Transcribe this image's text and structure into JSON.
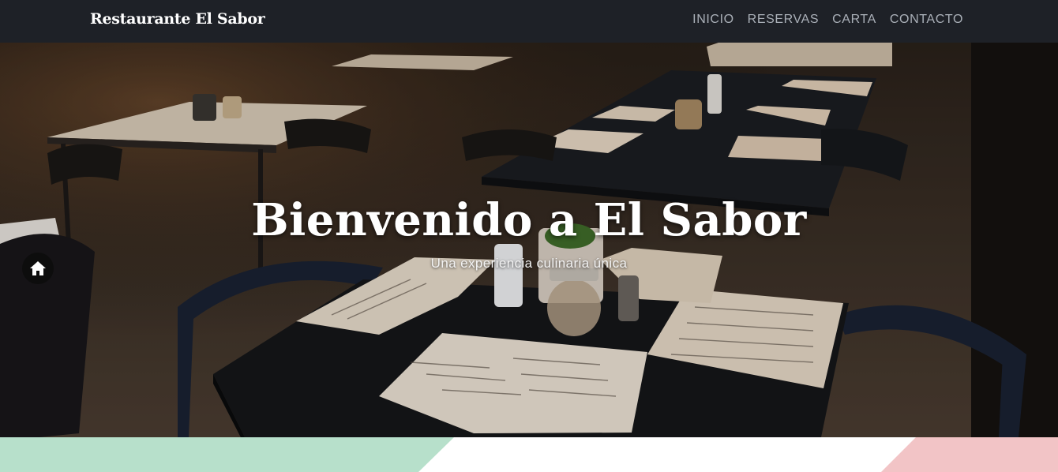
{
  "navbar": {
    "brand": "Restaurante El Sabor",
    "links": [
      {
        "label": "INICIO"
      },
      {
        "label": "RESERVAS"
      },
      {
        "label": "CARTA"
      },
      {
        "label": "CONTACTO"
      }
    ]
  },
  "hero": {
    "title": "Bienvenido a El Sabor",
    "subtitle": "Una experiencia culinaria única",
    "home_button_icon": "home-icon"
  },
  "colors": {
    "navbar_bg": "#1e2127",
    "strip_green": "#b7e0cb",
    "strip_pink": "#f2c4c6",
    "strip_white": "#ffffff"
  }
}
